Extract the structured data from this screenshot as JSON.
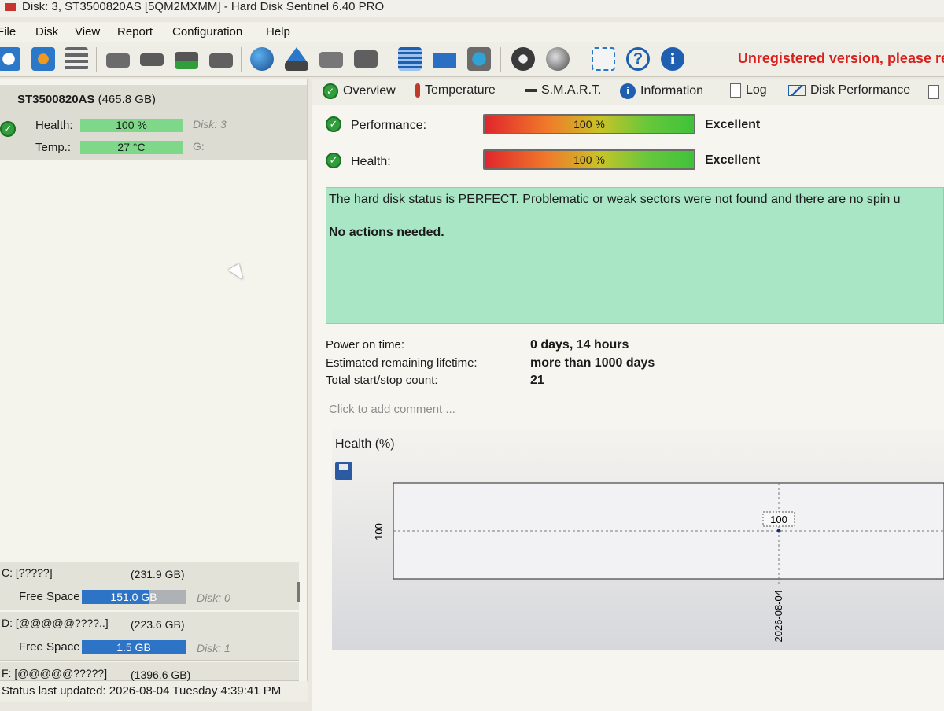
{
  "window": {
    "title": "Disk: 3, ST3500820AS [5QM2MXMM]  -  Hard Disk Sentinel 6.40 PRO"
  },
  "menu": [
    "File",
    "Disk",
    "View",
    "Report",
    "Configuration",
    "Help"
  ],
  "toolbar": {
    "icons": [
      "refresh-icon",
      "refresh-all-icon",
      "list-icon",
      "disk-tool-icon",
      "disk-clock-icon",
      "disk-check-icon",
      "disk-search-icon",
      "globe-icon",
      "eject-icon",
      "drive-icon",
      "drive-stack-icon",
      "notes-icon",
      "mail-icon",
      "network-icon",
      "settings-icon",
      "sound-icon",
      "screenshot-icon",
      "help-icon",
      "info-icon"
    ],
    "unregistered": "Unregistered version, please re"
  },
  "disk": {
    "model": "ST3500820AS",
    "size": "(465.8 GB)",
    "health_label": "Health:",
    "health_value": "100 %",
    "disk_no": "Disk: 3",
    "temp_label": "Temp.:",
    "temp_value": "27 °C",
    "drive_letter": "G:"
  },
  "volumes": [
    {
      "name": "C: [?????]",
      "size": "(231.9 GB)",
      "free_label": "Free Space",
      "free": "151.0 GB",
      "free_fraction": 0.65,
      "disk": "Disk: 0"
    },
    {
      "name": "D: [@@@@@????..]",
      "size": "(223.6 GB)",
      "free_label": "Free Space",
      "free": "1.5 GB",
      "free_fraction": 1.0,
      "disk": "Disk: 1"
    },
    {
      "name": "F: [@@@@@?????]",
      "size": "(1396.6 GB)"
    }
  ],
  "status": "Status last updated: 2026-08-04 Tuesday 4:39:41 PM",
  "tabs": [
    "Overview",
    "Temperature",
    "S.M.A.R.T.",
    "Information",
    "Log",
    "Disk Performance"
  ],
  "overview": {
    "performance_label": "Performance:",
    "performance_value": "100 %",
    "performance_rating": "Excellent",
    "health_label": "Health:",
    "health_value": "100 %",
    "health_rating": "Excellent",
    "status_text": "The hard disk status is PERFECT. Problematic or weak sectors were not found and there are no spin u",
    "actions": "No actions needed.",
    "power_on_label": "Power on time:",
    "power_on_value": "0 days, 14 hours",
    "lifetime_label": "Estimated remaining lifetime:",
    "lifetime_value": "more than 1000 days",
    "startstop_label": "Total start/stop count:",
    "startstop_value": "21",
    "comment_placeholder": "Click to add comment ..."
  },
  "chart_data": {
    "type": "scatter",
    "title": "Health (%)",
    "x": [
      "2026-08-04"
    ],
    "y": [
      100
    ],
    "data_labels": [
      "100"
    ],
    "y_tick": "100",
    "x_tick": "2026-08-04"
  }
}
